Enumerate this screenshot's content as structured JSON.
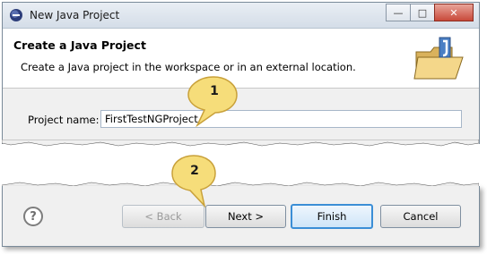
{
  "window": {
    "title": "New Java Project",
    "controls": {
      "minimize": "—",
      "maximize": "□",
      "close": "✕"
    }
  },
  "banner": {
    "title": "Create a Java Project",
    "description": "Create a Java project in the workspace or in an external location."
  },
  "form": {
    "project_name_label": "Project name:",
    "project_name_value": "FirstTestNGProject"
  },
  "footer": {
    "help_label": "?",
    "back_label": "< Back",
    "next_label": "Next >",
    "finish_label": "Finish",
    "cancel_label": "Cancel"
  },
  "callouts": [
    {
      "number": "1"
    },
    {
      "number": "2"
    }
  ],
  "colors": {
    "default_button_border": "#3b8ed6",
    "callout_fill": "#f6dd7a",
    "callout_border": "#c9a13a"
  }
}
